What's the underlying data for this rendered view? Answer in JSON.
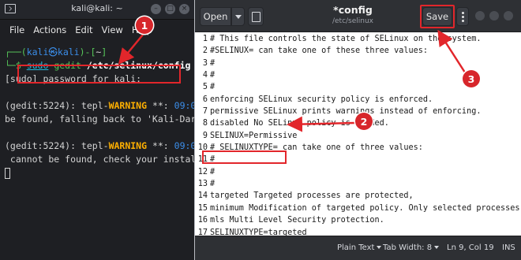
{
  "terminal": {
    "title": "kali@kali: ~",
    "menu": [
      "File",
      "Actions",
      "Edit",
      "View",
      "Help"
    ],
    "prompt": {
      "open": "┌──(",
      "user": "kali㉿kali",
      "close": ")-[",
      "dir": "~",
      "end": "]",
      "line2": "└─$ ",
      "sudo": "sudo",
      "cmd": " gedit ",
      "arg": "/etc/selinux/config"
    },
    "sudo_prompt": "[sudo] password for kali:",
    "warn1": {
      "pre": "(gedit:5224): tepl-",
      "level": "WARNING",
      "post": " **: ",
      "time": "09:0"
    },
    "warn1_cont": "be found, falling back to 'Kali-Dar",
    "warn2": {
      "pre": "(gedit:5224): tepl-",
      "level": "WARNING",
      "post": " **: ",
      "time": "09:0"
    },
    "warn2_cont": " cannot be found, check your instal"
  },
  "gedit": {
    "open_label": "Open",
    "title": "*config",
    "path": "/etc/selinux",
    "save_label": "Save",
    "lines": [
      "# This file controls the state of SELinux on the system.",
      "#SELINUX= can take one of these three values:",
      "#",
      "#",
      "#",
      "enforcing SELinux security policy is enforced.",
      "permissive SELinux prints warnings instead of enforcing.",
      "disabled No SELinux policy is loaded.",
      "SELINUX=Permissive",
      "# SELINUXTYPE= can take one of three values:",
      "#",
      "#",
      "#",
      "targeted Targeted processes are protected,",
      "minimum Modification of targeted policy. Only selected processes are protected.",
      "mls Multi Level Security protection.",
      "SELINUXTYPE=targeted"
    ],
    "status": {
      "language": "Plain Text",
      "tab_width": "Tab Width: 8",
      "position": "Ln 9, Col 19",
      "mode": "INS"
    }
  },
  "callouts": [
    "1",
    "2",
    "3"
  ],
  "colors": {
    "highlight": "#e2262b",
    "callout": "#d7262b"
  }
}
